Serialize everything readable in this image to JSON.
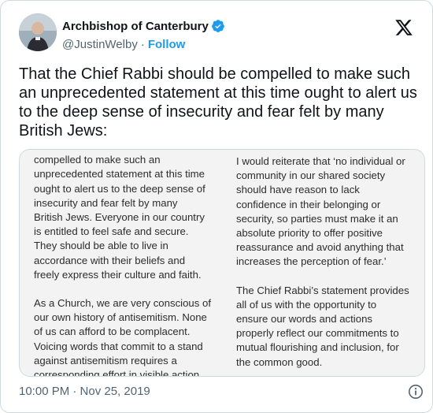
{
  "author": {
    "display_name": "Archbishop of Canterbury",
    "handle": "@JustinWelby",
    "separator": "·",
    "follow_label": "Follow",
    "verified_color": "#1d9bf0"
  },
  "icons": {
    "verified": "verified-badge-icon",
    "brand": "x-logo-icon",
    "info": "info-icon"
  },
  "tweet": {
    "text": "That the Chief Rabbi should be compelled to make such an unprecedented statement at this time ought to alert us to the deep sense of insecurity and fear felt by many British Jews:",
    "timestamp": "10:00 PM · Nov 25, 2019"
  },
  "image_text": {
    "left_column": [
      "That the Chief Rabbi should be\ncompelled to make such an\nunprecedented statement at this time\nought to alert us to the deep sense of\ninsecurity and fear felt by many\nBritish Jews. Everyone in our country\nis entitled to feel safe and secure.\nThey should be able to live in\naccordance with their beliefs and\nfreely express their culture and faith.",
      "As a Church, we are very conscious of\nour own history of antisemitism. None\nof us can afford to be complacent.\nVoicing words that commit to a stand\nagainst antisemitism requires a\ncorresponding effort in visible action."
    ],
    "right_column": [
      "I would reiterate that ‘no individual or\ncommunity in our shared society\nshould have reason to lack\nconfidence in their belonging or\nsecurity, so parties must make it an\nabsolute priority to offer positive\nreassurance and avoid anything that\nincreases the perception of fear.’",
      "The Chief Rabbi’s statement provides\nall of us with the opportunity to\nensure our words and actions\nproperly reflect our commitments to\nmutual flourishing and inclusion, for\nthe common good."
    ]
  }
}
